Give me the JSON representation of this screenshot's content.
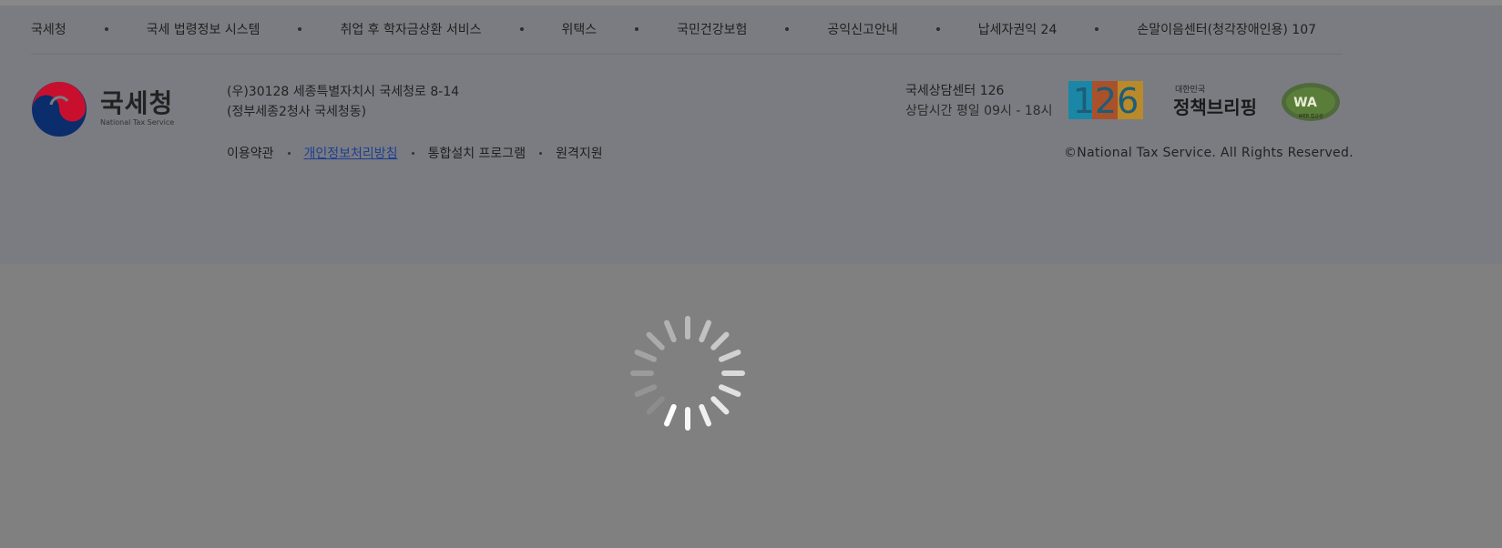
{
  "family_sites": [
    {
      "label": "국세청"
    },
    {
      "label": "국세 법령정보 시스템"
    },
    {
      "label": "취업 후 학자금상환 서비스"
    },
    {
      "label": "위택스"
    },
    {
      "label": "국민건강보험"
    },
    {
      "label": "공익신고안내"
    },
    {
      "label": "납세자권익 24"
    },
    {
      "label": "손말이음센터(청각장애인용) 107"
    }
  ],
  "logo": {
    "name": "국세청",
    "sub": "National Tax Service"
  },
  "address": {
    "line1": "(우)30128 세종특별자치시 국세청로 8-14",
    "line2": "(정부세종2청사 국세청동)"
  },
  "policy_links": [
    {
      "label": "이용약관"
    },
    {
      "label": "개인정보처리방침"
    },
    {
      "label": "통합설치 프로그램"
    },
    {
      "label": "원격지원"
    }
  ],
  "call_center": {
    "title": "국세상담센터 126",
    "hours": "상담시간 평일 09시 - 18시"
  },
  "badges": {
    "center_126": "126",
    "briefing_small": "대한민국",
    "briefing_main": "정책브리핑",
    "wa_mark": "WA",
    "wa_caption": "WEB 접근성"
  },
  "copyright": "©National Tax Service. All Rights Reserved.",
  "colors": {
    "overlay_gray": "#808080",
    "footer_bg": "#7b7c82",
    "link_blue": "#1f3f8f",
    "logo_red": "#c8102e",
    "logo_navy": "#0b2d6b"
  }
}
